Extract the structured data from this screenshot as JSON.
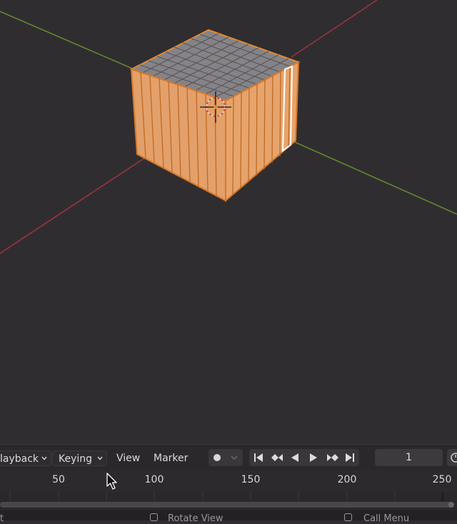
{
  "timeline": {
    "menus": {
      "playback": "layback",
      "keying": "Keying",
      "view": "View",
      "marker": "Marker"
    },
    "current_frame": "1",
    "ruler_labels": [
      "50",
      "100",
      "150",
      "200",
      "250"
    ]
  },
  "status_bar": {
    "left_text": "t",
    "middle_text": "Rotate View",
    "right_text": "Call Menu"
  },
  "colors": {
    "background": "#302d30",
    "x_axis": "#9a3440",
    "y_axis": "#5f8a2f",
    "selection_orange": "#e38a33",
    "active_edge": "#ffffff"
  },
  "icons": [
    "record-keyframe-icon",
    "jump-to-start-icon",
    "prev-keyframe-icon",
    "play-reverse-icon",
    "play-icon",
    "next-keyframe-icon",
    "jump-to-end-icon",
    "clock-icon",
    "mouse-cursor-icon"
  ]
}
